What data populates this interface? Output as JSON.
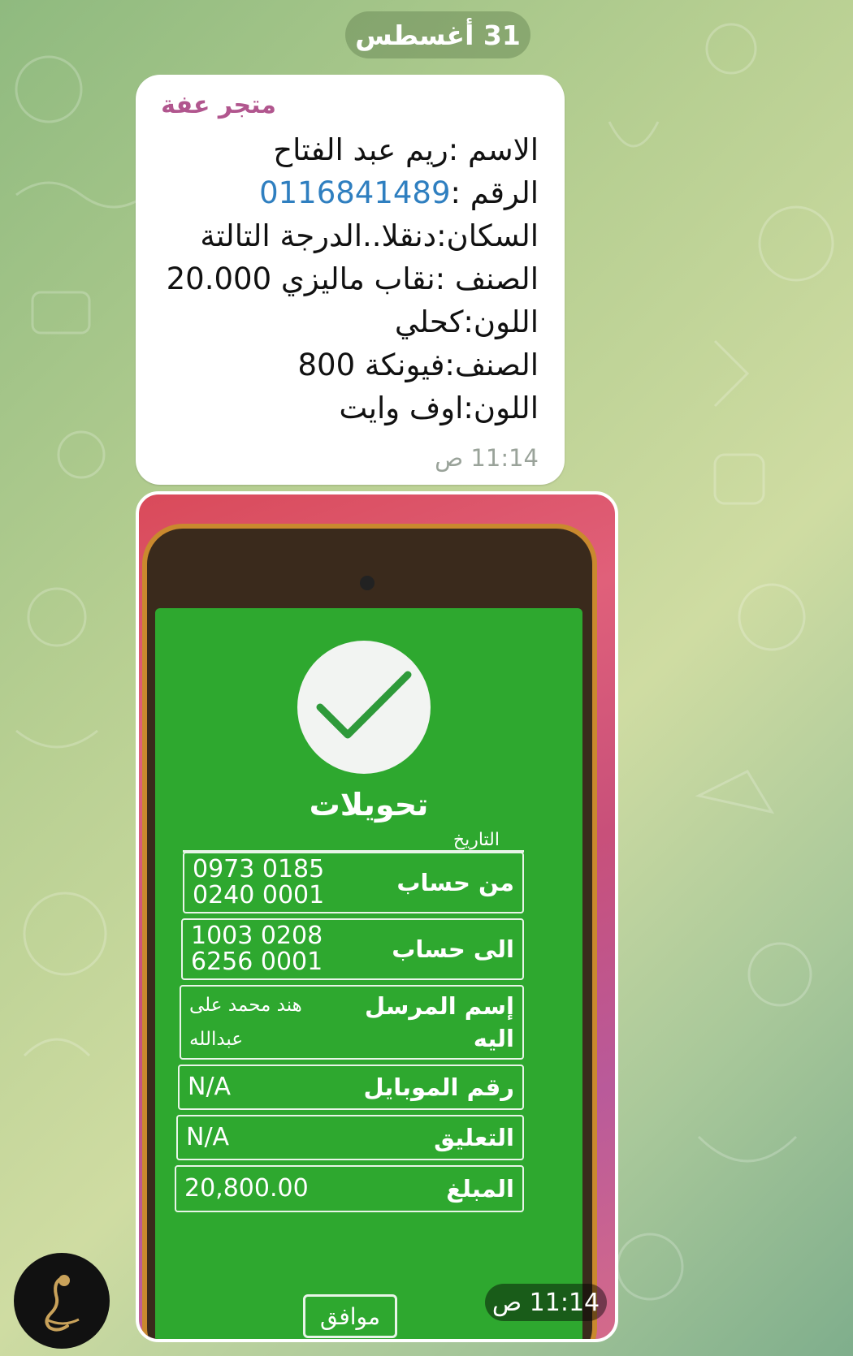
{
  "date_separator": "31 أغسطس",
  "message": {
    "sender": "متجر عفة",
    "lines": [
      "الاسم :ريم عبد الفتاح",
      "السكان:دنقلا..الدرجة التالتة",
      "الصنف :نقاب ماليزي 20.000",
      "اللون:كحلي",
      "الصنف:فيونكة 800",
      "اللون:اوف وايت"
    ],
    "phone_label": "الرقم :",
    "phone_number": "0116841489",
    "time": "11:14 ص"
  },
  "photo": {
    "time": "11:14 ص",
    "screen": {
      "title": "تحويلات",
      "partial_row_text": "التاريخ",
      "rows": [
        {
          "label": "من حساب",
          "value_line1": "0973 0185",
          "value_line2": "0240 0001"
        },
        {
          "label": "الى حساب",
          "value_line1": "1003 0208",
          "value_line2": "6256 0001"
        },
        {
          "label_line1": "إسم المرسل",
          "label_line2": "اليه",
          "value_line1": "هند محمد على",
          "value_line2": "عبدالله"
        },
        {
          "label": "رقم الموبايل",
          "value": "N/A"
        },
        {
          "label": "التعليق",
          "value": "N/A"
        },
        {
          "label": "المبلغ",
          "value": "20,800.00"
        }
      ],
      "ok_button": "موافق"
    }
  },
  "colors": {
    "sender_name": "#b1568e",
    "phone_link": "#2f7fc0",
    "screen_green": "#2ea82f"
  }
}
